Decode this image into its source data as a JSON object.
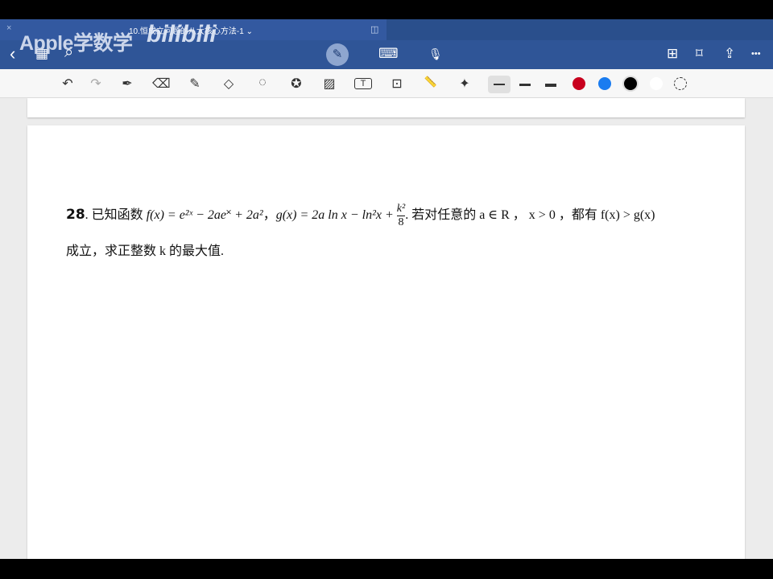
{
  "header": {
    "close": "×",
    "title": "10.恒成立问题的八大核心方法-1 ⌄",
    "watermark": "Apple学数学",
    "watermark_logo": "bilibili",
    "icons": {
      "back": "‹",
      "grid": "▦",
      "search": "⌕",
      "pen": "✎",
      "keyboard": "⌨",
      "mic": "🎙",
      "add_page": "⊞",
      "bookmark": "⌑",
      "share": "⇪",
      "more": "•••",
      "split": "◫"
    }
  },
  "toolbar": {
    "icons": {
      "undo": "↶",
      "redo": "↷",
      "pen": "✒",
      "eraser": "⌫",
      "highlighter": "✎",
      "shapes": "◇",
      "lasso": "◌",
      "sticker": "✪",
      "image": "▨",
      "text": "T",
      "screenshot": "⊡",
      "ruler": "📏",
      "laser": "✦"
    },
    "colors": [
      "#c8001e",
      "#1a7cf0",
      "#000000",
      "#ffffff"
    ]
  },
  "question": {
    "number": "28",
    "text_a": ". 已知函数 ",
    "f_def": "f(x) = e²ˣ − 2ae˟ + 2a²",
    "sep": "，",
    "g_def": "g(x) = 2a ln x − ln²x + ",
    "frac_num": "k²",
    "frac_den": "8",
    "text_b": ". 若对任意的 a ∈ R ， x > 0 ，都有 f(x) > g(x)",
    "line2": "成立，求正整数 k 的最大值."
  }
}
